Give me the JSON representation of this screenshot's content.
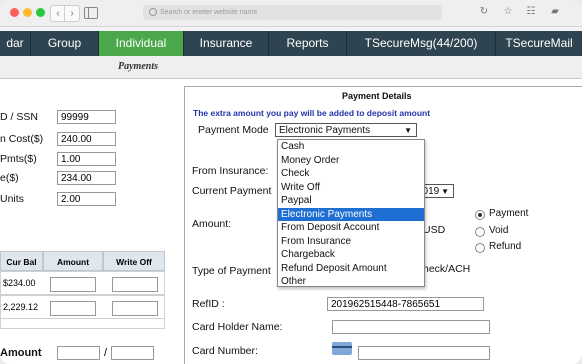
{
  "browser": {
    "url_placeholder": "Search or eneter website name"
  },
  "nav": {
    "tabs": [
      {
        "label": "dar"
      },
      {
        "label": "Group"
      },
      {
        "label": "Individual"
      },
      {
        "label": "Insurance"
      },
      {
        "label": "Reports"
      },
      {
        "label": "TSecureMsg(44/200)"
      },
      {
        "label": "TSecureMail"
      }
    ],
    "active_color": "#4aa84b",
    "bar_color": "#2f4451"
  },
  "page": {
    "subtitle": "Payments"
  },
  "left": {
    "fields": [
      {
        "label": "D / SSN",
        "value": "99999"
      },
      {
        "label": "n Cost($)",
        "value": "240.00"
      },
      {
        "label": "Pmts($)",
        "value": "1.00"
      },
      {
        "label": "e($)",
        "value": "234.00"
      },
      {
        "label": "Units",
        "value": "2.00"
      }
    ],
    "table": {
      "headers": [
        "Cur Bal",
        "Amount",
        "Write Off"
      ],
      "rows": [
        {
          "cur_bal": "$234.00"
        },
        {
          "cur_bal": "2,229.12"
        }
      ]
    },
    "amount_label": "Amount",
    "amount_sep": "/"
  },
  "payment": {
    "title": "Payment Details",
    "note": "The extra amount you pay will be added to deposit amount",
    "mode_label": "Payment Mode",
    "mode_value": "Electronic Payments",
    "from_insurance_label": "From Insurance:",
    "current_payment_label": "Current Payment",
    "current_payment_value": "2019",
    "amount_label": "Amount:",
    "currency": "USD",
    "radios": [
      {
        "label": "Payment",
        "checked": true
      },
      {
        "label": "Void",
        "checked": false
      },
      {
        "label": "Refund",
        "checked": false
      }
    ],
    "type_label": "Type of Payment",
    "type_value_fragment": "heck/ACH",
    "refid_label": "RefID :",
    "refid_value": "201962515448-7865651",
    "card_holder_label": "Card Holder Name:",
    "card_number_label": "Card Number:",
    "dropdown_options": [
      "Cash",
      "Money Order",
      "Check",
      "Write Off",
      "Paypal",
      "Electronic Payments",
      "From Deposit Account",
      "From Insurance",
      "Chargeback",
      "Refund Deposit Amount",
      "Other"
    ],
    "selected_option": "Electronic Payments"
  }
}
